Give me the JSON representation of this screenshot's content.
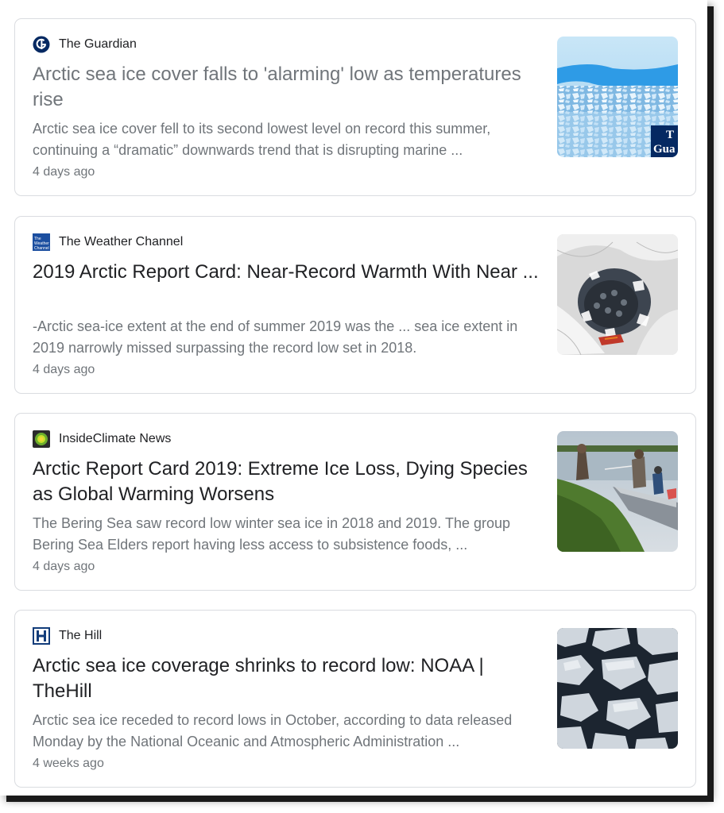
{
  "results": [
    {
      "source": "The Guardian",
      "logo_icon": "guardian-logo-icon",
      "title": "Arctic sea ice cover falls to 'alarming' low as temperatures rise",
      "snippet": "Arctic sea ice cover fell to its second lowest level on record this summer, continuing a “dramatic” downwards trend that is disrupting marine ...",
      "age": "4 days ago",
      "thumb_badge": "T Gua"
    },
    {
      "source": "The Weather Channel",
      "logo_icon": "weather-channel-logo-icon",
      "logo_text": "The Weather Channel",
      "title": "2019 Arctic Report Card: Near-Record Warmth With Near ...",
      "snippet": "-Arctic sea-ice extent at the end of summer 2019 was the ... sea ice extent in 2019 narrowly missed surpassing the record low set in 2018.",
      "age": "4 days ago"
    },
    {
      "source": "InsideClimate News",
      "logo_icon": "insideclimate-logo-icon",
      "title": "Arctic Report Card 2019: Extreme Ice Loss, Dying Species as Global Warming Worsens",
      "snippet": "The Bering Sea saw record low winter sea ice in 2018 and 2019. The group Bering Sea Elders report having less access to subsistence foods, ...",
      "age": "4 days ago"
    },
    {
      "source": "The Hill",
      "logo_icon": "the-hill-logo-icon",
      "logo_text": "H",
      "title": "Arctic sea ice coverage shrinks to record low: NOAA | TheHill",
      "snippet": "Arctic sea ice receded to record lows in October, according to data released Monday by the National Oceanic and Atmospheric Administration ...",
      "age": "4 weeks ago"
    }
  ],
  "colors": {
    "title_visited": "#70757a",
    "title_default": "#202124",
    "snippet": "#70757a",
    "card_border": "#dadce0"
  }
}
